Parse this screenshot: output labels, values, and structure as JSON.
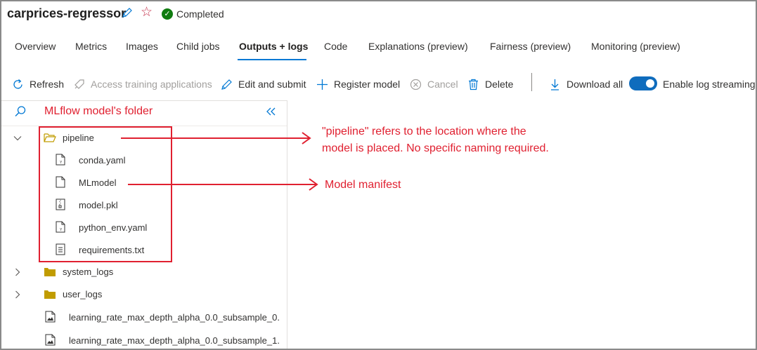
{
  "header": {
    "title": "carprices-regressor",
    "status": "Completed"
  },
  "tabs": [
    {
      "label": "Overview"
    },
    {
      "label": "Metrics"
    },
    {
      "label": "Images"
    },
    {
      "label": "Child jobs"
    },
    {
      "label": "Outputs + logs",
      "active": true
    },
    {
      "label": "Code"
    },
    {
      "label": "Explanations (preview)"
    },
    {
      "label": "Fairness (preview)"
    },
    {
      "label": "Monitoring (preview)"
    }
  ],
  "toolbar": {
    "refresh": "Refresh",
    "access_training": "Access training applications",
    "edit_submit": "Edit and submit",
    "register_model": "Register model",
    "cancel": "Cancel",
    "delete": "Delete",
    "download_all": "Download all",
    "log_streaming": "Enable log streaming",
    "log_streaming_on": true
  },
  "panel": {
    "title": "MLflow model's folder"
  },
  "tree": {
    "pipeline": {
      "label": "pipeline",
      "children": [
        "conda.yaml",
        "MLmodel",
        "model.pkl",
        "python_env.yaml",
        "requirements.txt"
      ]
    },
    "folders": [
      "system_logs",
      "user_logs"
    ],
    "files": [
      "learning_rate_max_depth_alpha_0.0_subsample_0.",
      "learning_rate_max_depth_alpha_0.0_subsample_1."
    ]
  },
  "annotations": {
    "pipeline_line1": "\"pipeline\" refers to the location where the",
    "pipeline_line2": "model is placed. No specific naming required.",
    "mlmodel": "Model manifest"
  },
  "colors": {
    "accent": "#0078d4",
    "annotation": "#e02030",
    "success": "#107c10",
    "folder": "#c19c00"
  }
}
